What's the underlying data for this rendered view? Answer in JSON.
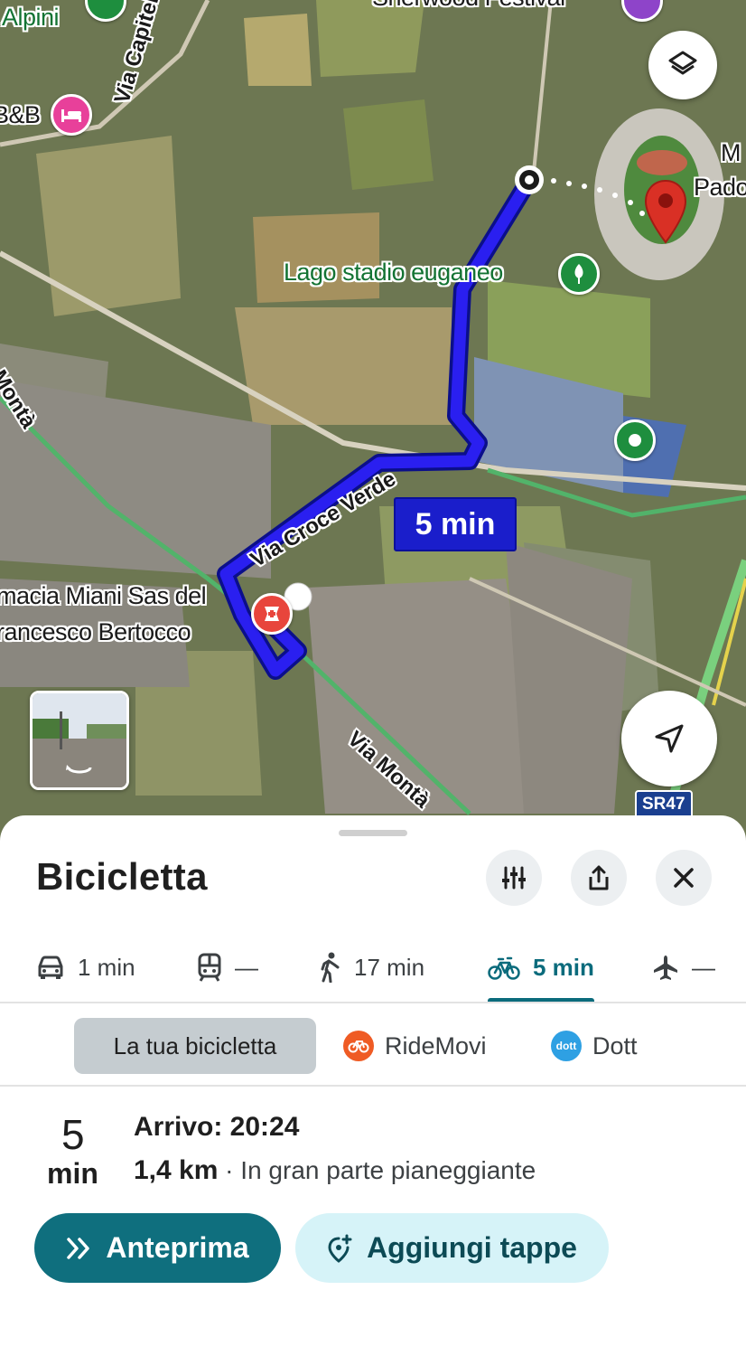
{
  "map": {
    "labels": {
      "alpini": "Alpini",
      "bnb": "B&B",
      "via_capitel": "Via Capitel",
      "sherwood": "Sherwood Festival",
      "m": "M",
      "pado": "Pado",
      "lago_stadio": "Lago stadio euganeo",
      "via_monta_top": "Montà",
      "via_croce_verde": "Via Croce Verde",
      "farmacia_1": "macia Miani Sas del",
      "farmacia_2": "rancesco Bertocco",
      "via_monta_bottom": "Via Montà",
      "sr47": "SR47"
    },
    "route_time": "5 min",
    "colors": {
      "route": "#1a1ecb",
      "destination_pin": "#d93025",
      "park_poi": "#1e8e3e",
      "hotel_poi": "#e8409a",
      "pharmacy_poi": "#e8453c"
    },
    "icons": {
      "layers": "layers-icon",
      "navigate": "navigation-arrow-icon",
      "streetview": "street-view-thumbnail"
    }
  },
  "sheet": {
    "title": "Bicicletta",
    "modes": [
      {
        "icon": "car-icon",
        "label": "1 min"
      },
      {
        "icon": "train-icon",
        "label": "—"
      },
      {
        "icon": "walk-icon",
        "label": "17 min"
      },
      {
        "icon": "bike-icon",
        "label": "5 min",
        "active": true
      },
      {
        "icon": "plane-icon",
        "label": "—"
      }
    ],
    "providers": {
      "selected": "La tua bicicletta",
      "ridemovi": "RideMovi",
      "dott": "Dott",
      "dott_logo_text": "dott"
    },
    "route": {
      "duration_number": "5",
      "duration_unit": "min",
      "arrival": "Arrivo: 20:24",
      "distance": "1,4 km",
      "separator": " · ",
      "terrain": "In gran parte pianeggiante"
    },
    "buttons": {
      "preview": "Anteprima",
      "add_stops": "Aggiungi tappe"
    }
  }
}
